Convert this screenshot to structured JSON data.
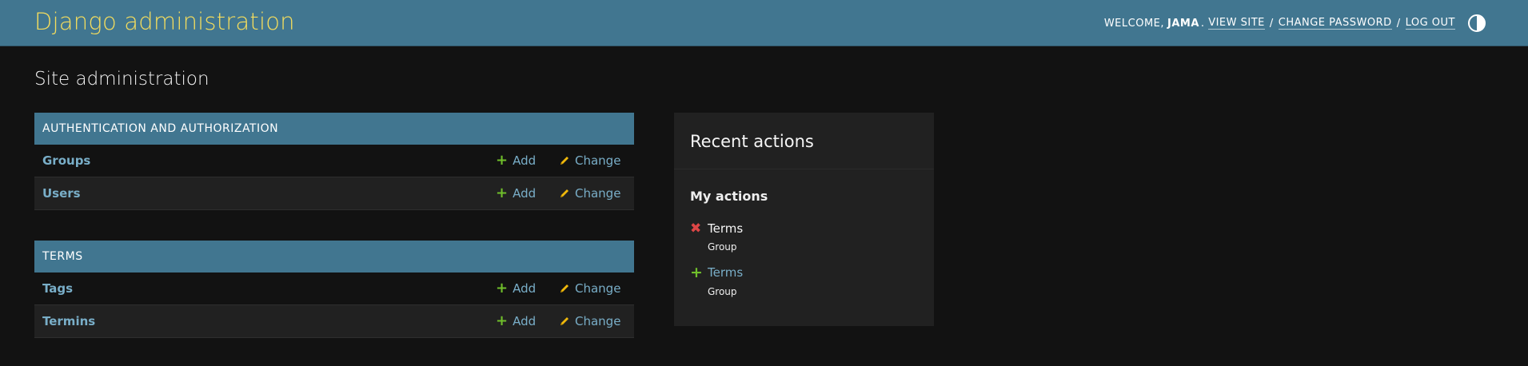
{
  "header": {
    "brand": "Django administration",
    "welcome": "WELCOME,",
    "username": "JAMA",
    "dot": ".",
    "view_site": "VIEW SITE",
    "change_password": "CHANGE PASSWORD",
    "log_out": "LOG OUT",
    "separator": "/"
  },
  "page_title": "Site administration",
  "apps": [
    {
      "name": "AUTHENTICATION AND AUTHORIZATION",
      "models": [
        {
          "name": "Groups",
          "add": "Add",
          "change": "Change"
        },
        {
          "name": "Users",
          "add": "Add",
          "change": "Change"
        }
      ]
    },
    {
      "name": "TERMS",
      "models": [
        {
          "name": "Tags",
          "add": "Add",
          "change": "Change"
        },
        {
          "name": "Termins",
          "add": "Add",
          "change": "Change"
        }
      ]
    }
  ],
  "recent_actions": {
    "title": "Recent actions",
    "subtitle": "My actions",
    "items": [
      {
        "action": "delete",
        "object": "Terms",
        "type": "Group"
      },
      {
        "action": "add",
        "object": "Terms",
        "type": "Group"
      }
    ]
  },
  "colors": {
    "header_bg": "#417690",
    "brand": "#f5dd5d",
    "link": "#79aec8",
    "add_icon": "#70bf2b",
    "change_icon": "#efb80b",
    "delete_icon": "#dd4646",
    "page_bg": "#121212"
  },
  "icons": {
    "theme_toggle": "half-circle-icon",
    "add": "plus-icon",
    "change": "pencil-icon",
    "delete": "x-icon"
  }
}
